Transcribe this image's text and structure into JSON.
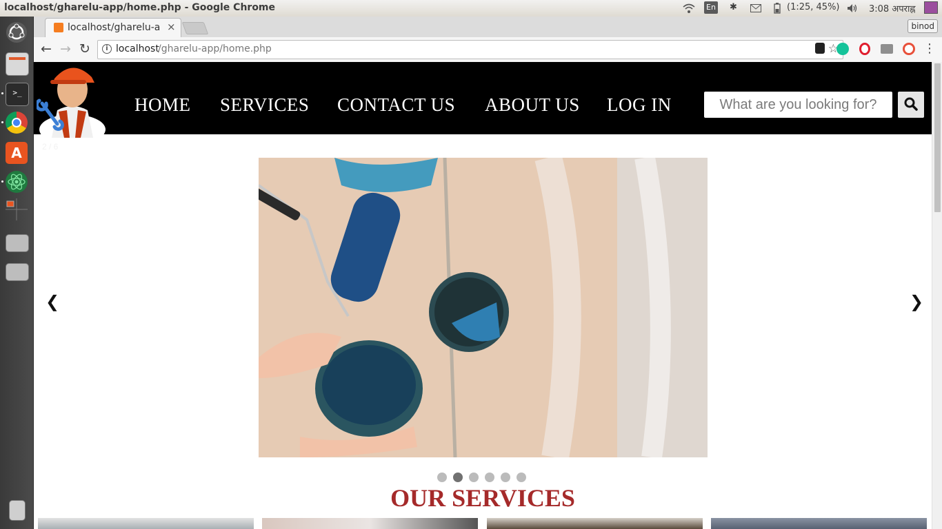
{
  "system_bar": {
    "window_title": "localhost/gharelu-app/home.php - Google Chrome",
    "keyboard_layout": "En",
    "battery": "(1:25, 45%)",
    "clock": "3:08 अपराह्न",
    "icons": [
      "wifi-icon",
      "bluetooth-icon",
      "mail-icon",
      "battery-icon",
      "volume-icon",
      "session-icon"
    ]
  },
  "launcher": {
    "items": [
      "ubuntu-dash-icon",
      "files-icon",
      "terminal-icon",
      "chrome-icon",
      "software-center-icon",
      "atom-icon",
      "workspace-icon",
      "drive-icon",
      "drive-icon",
      "trash-icon"
    ]
  },
  "browser": {
    "tab_title": "localhost/gharelu-a",
    "tab_close": "×",
    "profile": "binod",
    "url_host": "localhost",
    "url_path": "/gharelu-app/home.php",
    "extensions": [
      "gnome-icon",
      "grammarly-icon",
      "opera-icon",
      "screenshot-icon",
      "record-icon"
    ]
  },
  "site": {
    "nav": [
      "HOME",
      "SERVICES",
      "CONTACT US",
      "ABOUT US",
      "LOG IN"
    ],
    "search_placeholder": "What are you looking for?",
    "slide_counter": "2 / 6",
    "prev_arrow": "❮",
    "next_arrow": "❯",
    "dot_count": 6,
    "active_dot": 2,
    "services_heading": "OUR SERVICES"
  },
  "colors": {
    "header_bg": "#000000",
    "heading": "#a52a2a",
    "active_dot": "#717171",
    "dot": "#bbbbbb"
  }
}
